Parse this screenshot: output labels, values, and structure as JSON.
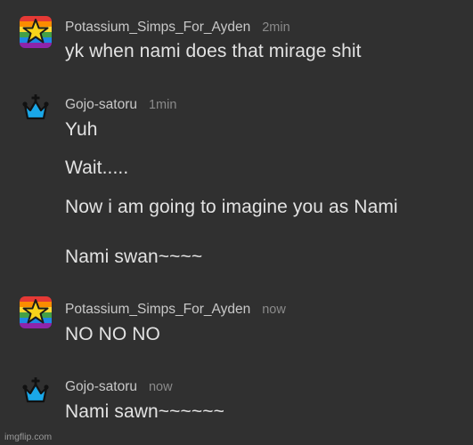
{
  "messages": [
    {
      "username": "Potassium_Simps_For_Ayden",
      "time": "2min",
      "avatar_icon": "rainbow-star-icon",
      "lines": [
        "yk when nami does that mirage shit"
      ]
    },
    {
      "username": "Gojo-satoru",
      "time": "1min",
      "avatar_icon": "blue-crown-icon",
      "lines": [
        "Yuh",
        "Wait.....",
        "Now i am going to imagine you as Nami",
        "Nami swan~~~~"
      ]
    },
    {
      "username": "Potassium_Simps_For_Ayden",
      "time": "now",
      "avatar_icon": "rainbow-star-icon",
      "lines": [
        "NO NO NO"
      ]
    },
    {
      "username": "Gojo-satoru",
      "time": "now",
      "avatar_icon": "blue-crown-icon",
      "lines": [
        "Nami sawn~~~~~~"
      ]
    }
  ],
  "watermark": "imgflip.com",
  "colors": {
    "background": "#303030",
    "crown_blue": "#1aa7e8",
    "star_yellow": "#f7d31a"
  }
}
